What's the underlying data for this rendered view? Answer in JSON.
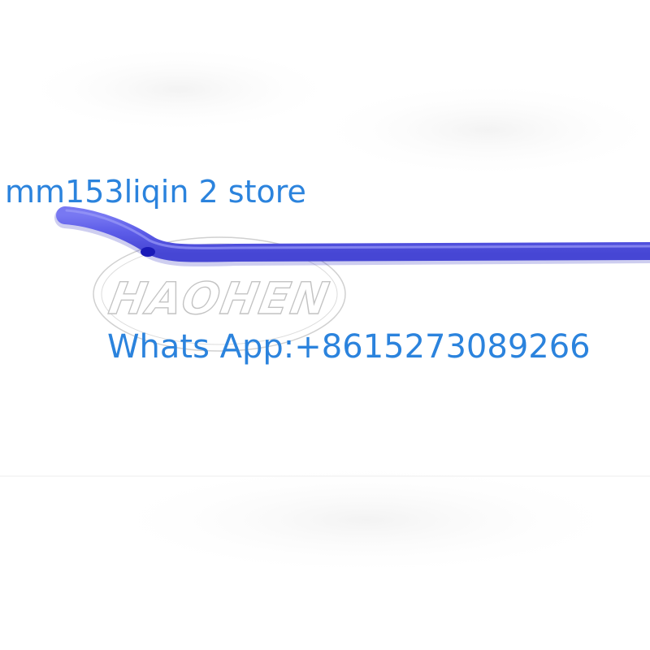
{
  "watermark": {
    "store_text": "mm153liqin 2 store",
    "contact_text": "Whats App:+8615273089266",
    "color": "#2b83dd"
  },
  "logo": {
    "text": "HAOHEN"
  },
  "product": {
    "tube_color": "#5a5ae8"
  }
}
